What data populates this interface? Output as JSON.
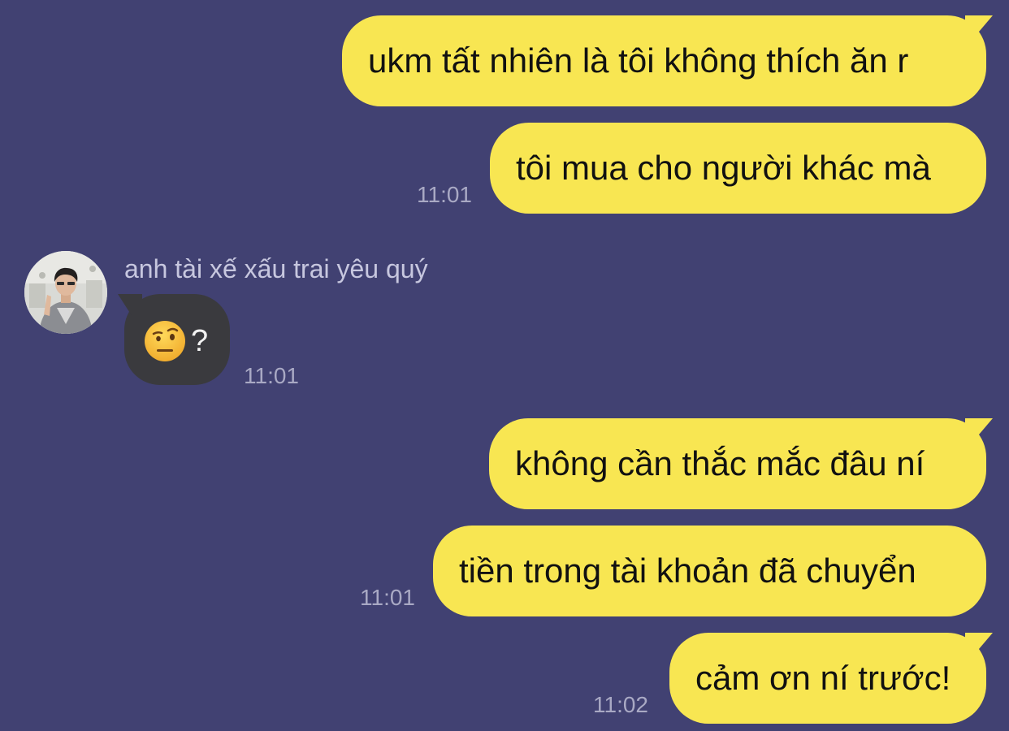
{
  "messages": {
    "m1": {
      "text": "ukm tất nhiên là tôi không thích ăn r"
    },
    "m2": {
      "text": "tôi mua cho người khác mà",
      "time": "11:01"
    },
    "m3": {
      "sender": "anh tài xế xấu trai yêu quý",
      "emoji": "face-with-raised-eyebrow",
      "text": "?",
      "time": "11:01"
    },
    "m4": {
      "text": "không cần thắc mắc đâu ní"
    },
    "m5": {
      "text": "tiền trong tài khoản đã chuyển",
      "time": "11:01"
    },
    "m6": {
      "text": "cảm ơn ní trước!",
      "time": "11:02"
    }
  },
  "colors": {
    "background": "#414172",
    "outgoing_bubble": "#f8e652",
    "incoming_bubble": "#3a3a3e",
    "timestamp": "#a9a9c4"
  }
}
